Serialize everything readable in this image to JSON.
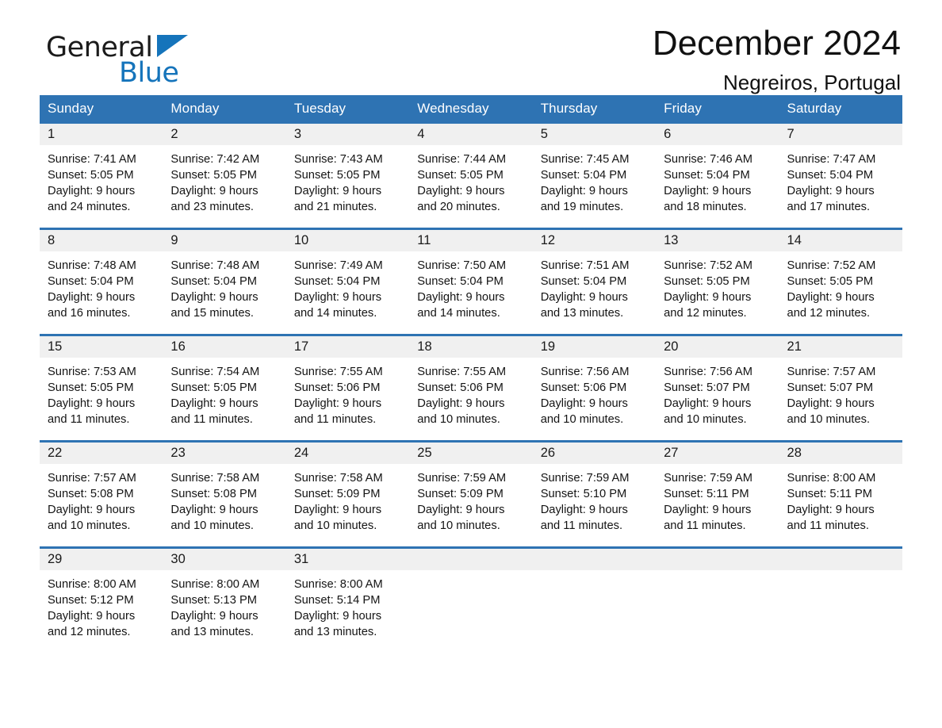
{
  "brand": {
    "name_part1": "General",
    "name_part2": "Blue",
    "triangle_color": "#1574bb"
  },
  "header": {
    "month_title": "December 2024",
    "location": "Negreiros, Portugal"
  },
  "theme": {
    "header_blue": "#2e73b3",
    "daynum_background": "#f0f0f0",
    "text_color": "#141414"
  },
  "calendar": {
    "weekday_headers": [
      "Sunday",
      "Monday",
      "Tuesday",
      "Wednesday",
      "Thursday",
      "Friday",
      "Saturday"
    ],
    "weeks": [
      [
        {
          "day": "1",
          "sunrise": "Sunrise: 7:41 AM",
          "sunset": "Sunset: 5:05 PM",
          "daylight_line1": "Daylight: 9 hours",
          "daylight_line2": "and 24 minutes."
        },
        {
          "day": "2",
          "sunrise": "Sunrise: 7:42 AM",
          "sunset": "Sunset: 5:05 PM",
          "daylight_line1": "Daylight: 9 hours",
          "daylight_line2": "and 23 minutes."
        },
        {
          "day": "3",
          "sunrise": "Sunrise: 7:43 AM",
          "sunset": "Sunset: 5:05 PM",
          "daylight_line1": "Daylight: 9 hours",
          "daylight_line2": "and 21 minutes."
        },
        {
          "day": "4",
          "sunrise": "Sunrise: 7:44 AM",
          "sunset": "Sunset: 5:05 PM",
          "daylight_line1": "Daylight: 9 hours",
          "daylight_line2": "and 20 minutes."
        },
        {
          "day": "5",
          "sunrise": "Sunrise: 7:45 AM",
          "sunset": "Sunset: 5:04 PM",
          "daylight_line1": "Daylight: 9 hours",
          "daylight_line2": "and 19 minutes."
        },
        {
          "day": "6",
          "sunrise": "Sunrise: 7:46 AM",
          "sunset": "Sunset: 5:04 PM",
          "daylight_line1": "Daylight: 9 hours",
          "daylight_line2": "and 18 minutes."
        },
        {
          "day": "7",
          "sunrise": "Sunrise: 7:47 AM",
          "sunset": "Sunset: 5:04 PM",
          "daylight_line1": "Daylight: 9 hours",
          "daylight_line2": "and 17 minutes."
        }
      ],
      [
        {
          "day": "8",
          "sunrise": "Sunrise: 7:48 AM",
          "sunset": "Sunset: 5:04 PM",
          "daylight_line1": "Daylight: 9 hours",
          "daylight_line2": "and 16 minutes."
        },
        {
          "day": "9",
          "sunrise": "Sunrise: 7:48 AM",
          "sunset": "Sunset: 5:04 PM",
          "daylight_line1": "Daylight: 9 hours",
          "daylight_line2": "and 15 minutes."
        },
        {
          "day": "10",
          "sunrise": "Sunrise: 7:49 AM",
          "sunset": "Sunset: 5:04 PM",
          "daylight_line1": "Daylight: 9 hours",
          "daylight_line2": "and 14 minutes."
        },
        {
          "day": "11",
          "sunrise": "Sunrise: 7:50 AM",
          "sunset": "Sunset: 5:04 PM",
          "daylight_line1": "Daylight: 9 hours",
          "daylight_line2": "and 14 minutes."
        },
        {
          "day": "12",
          "sunrise": "Sunrise: 7:51 AM",
          "sunset": "Sunset: 5:04 PM",
          "daylight_line1": "Daylight: 9 hours",
          "daylight_line2": "and 13 minutes."
        },
        {
          "day": "13",
          "sunrise": "Sunrise: 7:52 AM",
          "sunset": "Sunset: 5:05 PM",
          "daylight_line1": "Daylight: 9 hours",
          "daylight_line2": "and 12 minutes."
        },
        {
          "day": "14",
          "sunrise": "Sunrise: 7:52 AM",
          "sunset": "Sunset: 5:05 PM",
          "daylight_line1": "Daylight: 9 hours",
          "daylight_line2": "and 12 minutes."
        }
      ],
      [
        {
          "day": "15",
          "sunrise": "Sunrise: 7:53 AM",
          "sunset": "Sunset: 5:05 PM",
          "daylight_line1": "Daylight: 9 hours",
          "daylight_line2": "and 11 minutes."
        },
        {
          "day": "16",
          "sunrise": "Sunrise: 7:54 AM",
          "sunset": "Sunset: 5:05 PM",
          "daylight_line1": "Daylight: 9 hours",
          "daylight_line2": "and 11 minutes."
        },
        {
          "day": "17",
          "sunrise": "Sunrise: 7:55 AM",
          "sunset": "Sunset: 5:06 PM",
          "daylight_line1": "Daylight: 9 hours",
          "daylight_line2": "and 11 minutes."
        },
        {
          "day": "18",
          "sunrise": "Sunrise: 7:55 AM",
          "sunset": "Sunset: 5:06 PM",
          "daylight_line1": "Daylight: 9 hours",
          "daylight_line2": "and 10 minutes."
        },
        {
          "day": "19",
          "sunrise": "Sunrise: 7:56 AM",
          "sunset": "Sunset: 5:06 PM",
          "daylight_line1": "Daylight: 9 hours",
          "daylight_line2": "and 10 minutes."
        },
        {
          "day": "20",
          "sunrise": "Sunrise: 7:56 AM",
          "sunset": "Sunset: 5:07 PM",
          "daylight_line1": "Daylight: 9 hours",
          "daylight_line2": "and 10 minutes."
        },
        {
          "day": "21",
          "sunrise": "Sunrise: 7:57 AM",
          "sunset": "Sunset: 5:07 PM",
          "daylight_line1": "Daylight: 9 hours",
          "daylight_line2": "and 10 minutes."
        }
      ],
      [
        {
          "day": "22",
          "sunrise": "Sunrise: 7:57 AM",
          "sunset": "Sunset: 5:08 PM",
          "daylight_line1": "Daylight: 9 hours",
          "daylight_line2": "and 10 minutes."
        },
        {
          "day": "23",
          "sunrise": "Sunrise: 7:58 AM",
          "sunset": "Sunset: 5:08 PM",
          "daylight_line1": "Daylight: 9 hours",
          "daylight_line2": "and 10 minutes."
        },
        {
          "day": "24",
          "sunrise": "Sunrise: 7:58 AM",
          "sunset": "Sunset: 5:09 PM",
          "daylight_line1": "Daylight: 9 hours",
          "daylight_line2": "and 10 minutes."
        },
        {
          "day": "25",
          "sunrise": "Sunrise: 7:59 AM",
          "sunset": "Sunset: 5:09 PM",
          "daylight_line1": "Daylight: 9 hours",
          "daylight_line2": "and 10 minutes."
        },
        {
          "day": "26",
          "sunrise": "Sunrise: 7:59 AM",
          "sunset": "Sunset: 5:10 PM",
          "daylight_line1": "Daylight: 9 hours",
          "daylight_line2": "and 11 minutes."
        },
        {
          "day": "27",
          "sunrise": "Sunrise: 7:59 AM",
          "sunset": "Sunset: 5:11 PM",
          "daylight_line1": "Daylight: 9 hours",
          "daylight_line2": "and 11 minutes."
        },
        {
          "day": "28",
          "sunrise": "Sunrise: 8:00 AM",
          "sunset": "Sunset: 5:11 PM",
          "daylight_line1": "Daylight: 9 hours",
          "daylight_line2": "and 11 minutes."
        }
      ],
      [
        {
          "day": "29",
          "sunrise": "Sunrise: 8:00 AM",
          "sunset": "Sunset: 5:12 PM",
          "daylight_line1": "Daylight: 9 hours",
          "daylight_line2": "and 12 minutes."
        },
        {
          "day": "30",
          "sunrise": "Sunrise: 8:00 AM",
          "sunset": "Sunset: 5:13 PM",
          "daylight_line1": "Daylight: 9 hours",
          "daylight_line2": "and 13 minutes."
        },
        {
          "day": "31",
          "sunrise": "Sunrise: 8:00 AM",
          "sunset": "Sunset: 5:14 PM",
          "daylight_line1": "Daylight: 9 hours",
          "daylight_line2": "and 13 minutes."
        },
        {
          "day": "",
          "sunrise": "",
          "sunset": "",
          "daylight_line1": "",
          "daylight_line2": ""
        },
        {
          "day": "",
          "sunrise": "",
          "sunset": "",
          "daylight_line1": "",
          "daylight_line2": ""
        },
        {
          "day": "",
          "sunrise": "",
          "sunset": "",
          "daylight_line1": "",
          "daylight_line2": ""
        },
        {
          "day": "",
          "sunrise": "",
          "sunset": "",
          "daylight_line1": "",
          "daylight_line2": ""
        }
      ]
    ]
  }
}
